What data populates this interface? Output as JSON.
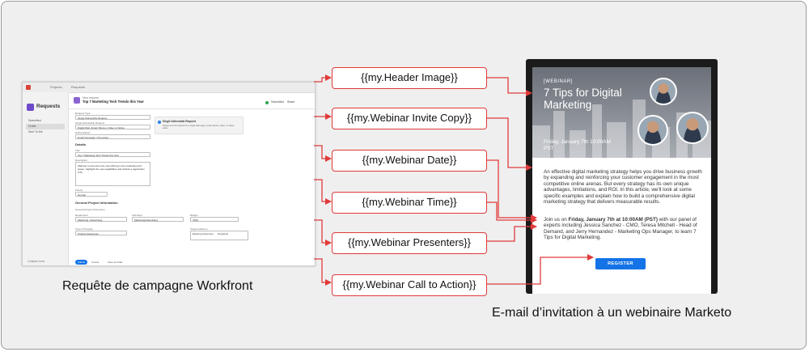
{
  "tokens": [
    "{{my.Header Image}}",
    "{{my.Webinar Invite Copy}}",
    "{{my.Webinar Date}}",
    "{{my.Webinar Time}}",
    "{{my.Webinar Presenters}}",
    "{{my.Webinar Call to Action}}"
  ],
  "captions": {
    "workfront": "Requête de campagne Workfront",
    "marketo": "E-mail d’invitation à un webinaire Marketo"
  },
  "workfront": {
    "nav": [
      "Projects",
      "Requests"
    ],
    "sidebar_title": "Requests",
    "sidebar_items": [
      "Submitted",
      "Drafts",
      "Sent To Me"
    ],
    "sidebar_footer": "Collapse menu",
    "request_type_label": "New request",
    "request_title": "Top 7 Marketing Tech Trends this Year",
    "status": "Submitted",
    "share": "Share",
    "fields": [
      {
        "label": "Request Type",
        "value": "Single Deliverable Request"
      },
      {
        "label": "Single Deliverable Request",
        "value": "Digital Web, Email, Banner, Video or Native"
      },
      {
        "label": "Deliverable(s)",
        "value": "Email Campaign / Promotion"
      }
    ],
    "info_title": "Single Deliverable Request",
    "info_text": "Please use this request for a single web page, email, banner, video, or native asset.",
    "details_heading": "Details",
    "title_label": "Title",
    "title_value": "Top 7 Marketing Tech Trends this Year",
    "description_label": "Description",
    "description_value": "Webinar to announce the new offering in the marketing tech space. Highlight the new capabilities and include a registration CTA.",
    "priority_label": "Priority",
    "priority_value": "Normal",
    "general_heading": "General Project Information",
    "general_sub": "General Project Information",
    "general_fields": [
      {
        "label": "Department",
        "value": "Marketing / Advertising"
      },
      {
        "label": "Sub-Dept.",
        "value": "Marketing/Advertising"
      },
      {
        "label": "Budget",
        "value": "7000"
      }
    ],
    "program_label": "Type of Program",
    "program_value": "Product Awareness",
    "audience_label": "Target Audience",
    "audience_tags": [
      "Existing Customers",
      "Prospects"
    ],
    "submit": "Submit",
    "cancel": "Cancel",
    "save_draft": "Save as Draft"
  },
  "marketo": {
    "tag": "[WEBINAR]",
    "headline": "7 Tips for Digital Marketing",
    "date_line": "Friday, January 7th 10:00AM PST",
    "body": "An effective digital marketing strategy helps you drive business growth by expanding and reinforcing your customer engagement in the most competitive online arenas. But every strategy has its own unique advantages, limitations, and ROI. In this article, we'll look at some specific examples and explain how to build a comprehensive digital marketing strategy that delivers measurable results.",
    "join_pre": "Join us on ",
    "join_bold": "Friday, January 7th at 10:00AM (PST)",
    "join_post": " with our panel of experts including Jessica Sanchez - CMO, Teresa Mitchell - Head of Demand, and Jerry Hernandez - Marketing Ops Manager, to learn 7 Tips for Digital Marketing.",
    "cta": "REGISTER"
  },
  "colors": {
    "connector": "#e03a3a",
    "cta": "#1473e6",
    "accent": "#6d4ac9"
  }
}
